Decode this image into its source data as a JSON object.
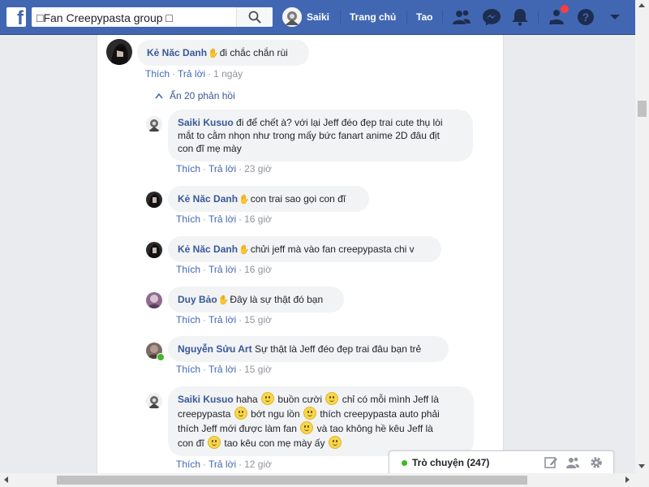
{
  "topbar": {
    "logo_letter": "f",
    "search_value": "□Fan Creepypasta group □",
    "profile_name": "Saiki",
    "nav_home": "Trang chủ",
    "nav_create": "Tao",
    "brand_color": "#4267b2"
  },
  "icons": [
    "search-icon",
    "friend-requests-icon",
    "messenger-icon",
    "notifications-icon",
    "community-icon",
    "help-icon",
    "dropdown-arrow-icon"
  ],
  "thread": {
    "parent": {
      "name": "Kẻ Năc Danh",
      "text": "đi chắc chắn rùi",
      "like": "Thích",
      "reply": "Trả lời",
      "time": "1 ngày"
    },
    "hide_replies": "Ẩn 20 phản hồi",
    "replies": [
      {
        "name": "Saiki Kusuo",
        "line1": "đi để chết à? với lại Jeff đéo đẹp trai cute thụ lòi",
        "line2": "mắt to cằm nhọn như trong mấy bức fanart anime 2D đâu địt",
        "line3": "con đĩ mẹ mày",
        "like": "Thích",
        "reply": "Trả lời",
        "time": "23 giờ"
      },
      {
        "name": "Kẻ Năc Danh",
        "text": "con trai sao gọi con đĩ",
        "like": "Thích",
        "reply": "Trả lời",
        "time": "16 giờ"
      },
      {
        "name": "Kẻ Năc Danh",
        "text": "chửi jeff mà vào fan creepypasta chi v",
        "like": "Thích",
        "reply": "Trả lời",
        "time": "16 giờ"
      },
      {
        "name": "Duy Bảo",
        "text": "Đây là sự thật đó bạn",
        "like": "Thích",
        "reply": "Trả lời",
        "time": "15 giờ"
      },
      {
        "name": "Nguyễn Sửu Art",
        "text": "Sự thật là Jeff đéo đẹp trai đâu bạn trẻ",
        "like": "Thích",
        "reply": "Trả lời",
        "time": "15 giờ"
      },
      {
        "name": "Saiki Kusuo",
        "seg1": "haha",
        "seg2": "buồn cười",
        "seg3": "chỉ có mỗi mình Jeff là",
        "seg4": "creepypasta",
        "seg5": "bớt ngu lồn",
        "seg6": "thích creepypasta auto phải",
        "seg7": "thích Jeff mới được làm fan",
        "seg8": "và tao không hề kêu Jeff là",
        "seg9": "con đĩ",
        "seg10": "tao kêu con mẹ mày ấy",
        "like": "Thích",
        "reply": "Trả lời",
        "time": "12 giờ"
      }
    ]
  },
  "chat": {
    "label": "Trò chuyện (247)"
  }
}
